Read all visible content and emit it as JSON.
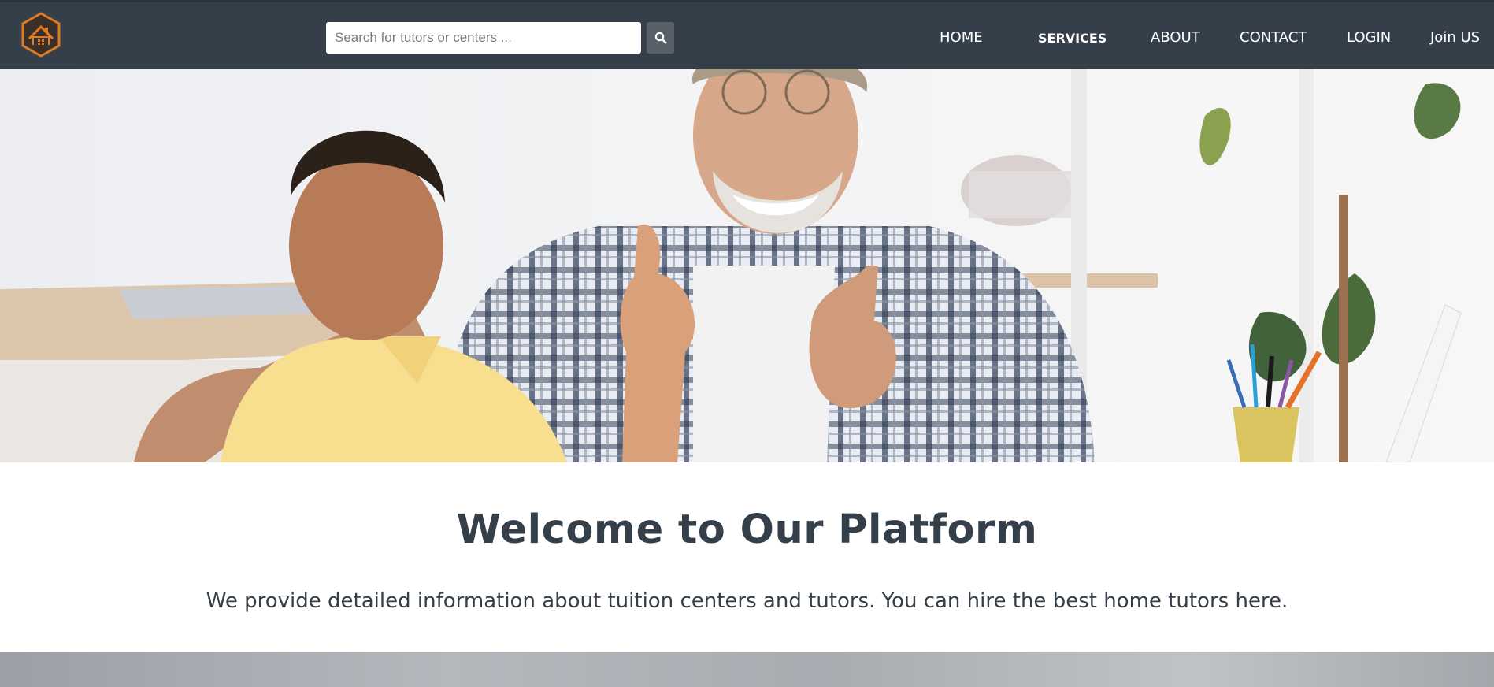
{
  "header": {
    "logo_icon": "house-hexagon-logo-icon",
    "search": {
      "placeholder": "Search for tutors or centers ...",
      "value": "",
      "button_icon": "search-icon"
    },
    "nav": {
      "home": "HOME",
      "services": "SERVICES",
      "about": "ABOUT",
      "contact": "CONTACT",
      "login": "LOGIN",
      "join": "Join US"
    }
  },
  "hero": {
    "image": "photo-boy-and-grandfather-thumbs-up"
  },
  "welcome": {
    "title": "Welcome to Our Platform",
    "text": "We provide detailed information about tuition centers and tutors. You can hire the best home tutors here."
  },
  "colors": {
    "header_bg": "#353f49",
    "text_dark": "#353f49",
    "logo_orange": "#e07b1f",
    "search_button": "#59606a"
  }
}
